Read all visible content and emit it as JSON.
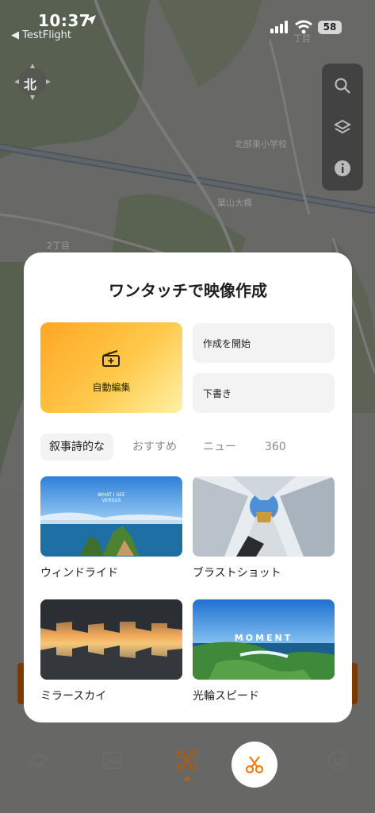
{
  "status_bar": {
    "time": "10:37",
    "back_app": "◀ TestFlight",
    "battery": "58"
  },
  "map": {
    "compass_label": "北",
    "labels": [
      "北部東小学校",
      "葉山大橋",
      "2丁目",
      "丁目",
      "3"
    ],
    "tools": [
      "search-icon",
      "layers-icon",
      "info-icon"
    ]
  },
  "modal": {
    "title": "ワンタッチで映像作成",
    "auto_edit_label": "自動編集",
    "start_create_label": "作成を開始",
    "draft_label": "下書き",
    "tabs": [
      "叙事詩的な",
      "おすすめ",
      "ニュー",
      "360"
    ],
    "active_tab": "叙事詩的な",
    "templates": [
      {
        "label": "ウィンドライド",
        "overlay": "WHAT I SEE\nVERSUS"
      },
      {
        "label": "ブラストショット",
        "overlay": ""
      },
      {
        "label": "ミラースカイ",
        "overlay": ""
      },
      {
        "label": "光輪スピード",
        "overlay": "MOMENT"
      }
    ]
  },
  "bottom_nav": {
    "items": [
      "planet-icon",
      "gallery-icon",
      "drone-icon",
      "scissors-icon",
      "smiley-icon"
    ],
    "active": "drone-icon"
  },
  "colors": {
    "accent": "#f07d0c",
    "auto_card_gradient_start": "#ffa623",
    "auto_card_gradient_end": "#fff0a6"
  }
}
